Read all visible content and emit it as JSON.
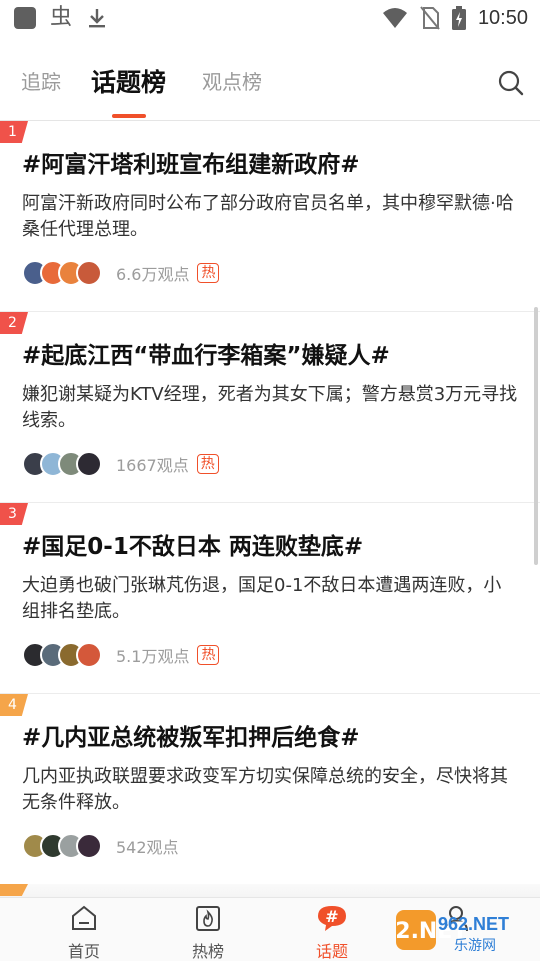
{
  "status_bar": {
    "time": "10:50",
    "left_glyph": "虫",
    "icons": [
      "app-square-icon",
      "bug-icon",
      "download-icon",
      "wifi-icon",
      "no-sim-icon",
      "battery-charging-icon"
    ]
  },
  "tabs": [
    {
      "label": "追踪",
      "active": false
    },
    {
      "label": "话题榜",
      "active": true
    },
    {
      "label": "观点榜",
      "active": false
    }
  ],
  "colors": {
    "accent": "#f0502a",
    "rank_red": "#f0524a",
    "rank_orange": "#f5a54a",
    "hot_badge": "#f0502a"
  },
  "topics": [
    {
      "rank": "1",
      "title": "#阿富汗塔利班宣布组建新政府#",
      "summary": "阿富汗新政府同时公布了部分政府官员名单，其中穆罕默德·哈桑任代理总理。",
      "views": "6.6万观点",
      "hot": "热"
    },
    {
      "rank": "2",
      "title": "#起底江西“带血行李箱案”嫌疑人#",
      "summary": "嫌犯谢某疑为KTV经理，死者为其女下属；警方悬赏3万元寻找线索。",
      "views": "1667观点",
      "hot": "热"
    },
    {
      "rank": "3",
      "title": "#国足0-1不敌日本 两连败垫底#",
      "summary": "大迫勇也破门张琳芃伤退，国足0-1不敌日本遭遇两连败，小组排名垫底。",
      "views": "5.1万观点",
      "hot": "热"
    },
    {
      "rank": "4",
      "title": "#几内亚总统被叛军扣押后绝食#",
      "summary": "几内亚执政联盟要求政变军方切实保障总统的安全，尽快将其无条件释放。",
      "views": "542观点",
      "hot": ""
    }
  ],
  "bottom_nav": [
    {
      "label": "首页",
      "icon": "home-icon",
      "active": false
    },
    {
      "label": "热榜",
      "icon": "hot-list-icon",
      "active": false
    },
    {
      "label": "话题",
      "icon": "topic-hash-icon",
      "active": true
    },
    {
      "label": "",
      "icon": "profile-icon",
      "active": false
    }
  ],
  "watermark": {
    "main": "962.NET",
    "sub": "乐游网"
  }
}
